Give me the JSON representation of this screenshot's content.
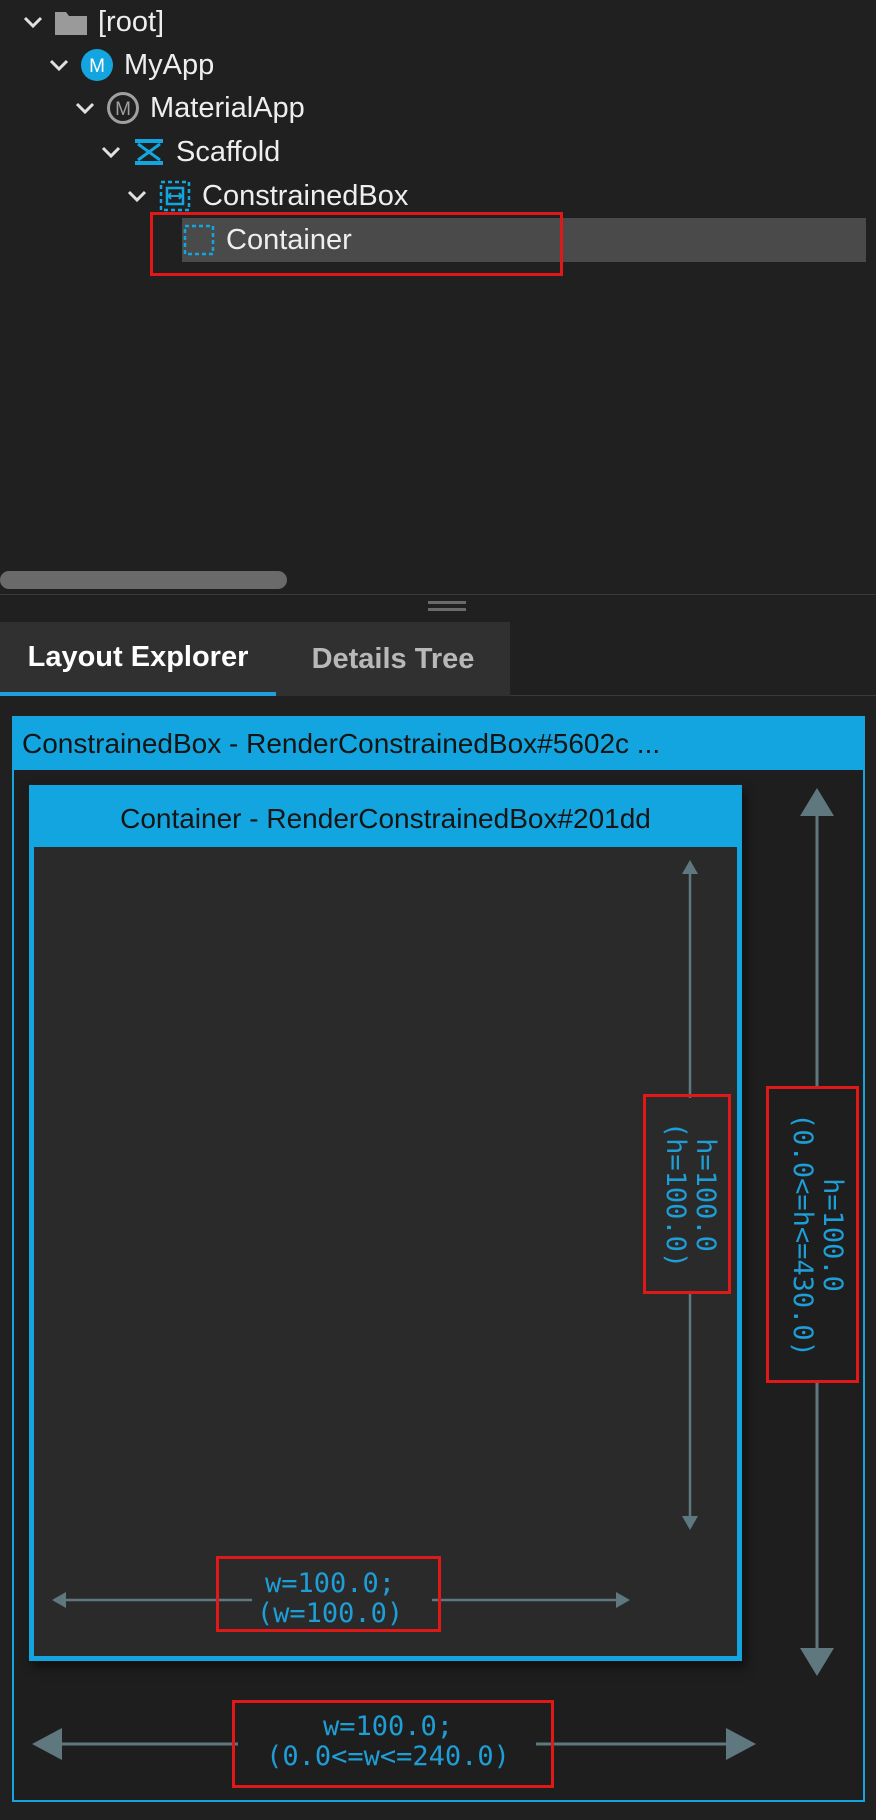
{
  "tree": {
    "nodes": [
      {
        "label": "[root]",
        "icon": "folder-icon",
        "icon_letter": ""
      },
      {
        "label": "MyApp",
        "icon": "myapp-badge-icon",
        "icon_letter": "M"
      },
      {
        "label": "MaterialApp",
        "icon": "materialapp-badge-icon",
        "icon_letter": "M"
      },
      {
        "label": "Scaffold",
        "icon": "scaffold-icon",
        "icon_letter": ""
      },
      {
        "label": "ConstrainedBox",
        "icon": "constrained-box-icon",
        "icon_letter": ""
      },
      {
        "label": "Container",
        "icon": "container-icon",
        "icon_letter": "",
        "selected": true
      }
    ]
  },
  "tabs": [
    {
      "label": "Layout Explorer",
      "active": true
    },
    {
      "label": "Details Tree",
      "active": false
    }
  ],
  "layout_explorer": {
    "outer_title": "ConstrainedBox - RenderConstrainedBox#5602c ...",
    "inner_title": "Container - RenderConstrainedBox#201dd",
    "inner_height_line1": "h=100.0",
    "inner_height_line2": "(h=100.0)",
    "inner_width_line1": "w=100.0;",
    "inner_width_line2": "(w=100.0)",
    "outer_height_line1": "h=100.0",
    "outer_height_line2": "(0.0<=h<=430.0)",
    "outer_width_line1": "w=100.0;",
    "outer_width_line2": "(0.0<=w<=240.0)"
  },
  "colors": {
    "accent": "#13a5df",
    "annotation_red": "#e01818",
    "dimension_text": "#1e9ed6",
    "arrow": "#5f7880"
  }
}
